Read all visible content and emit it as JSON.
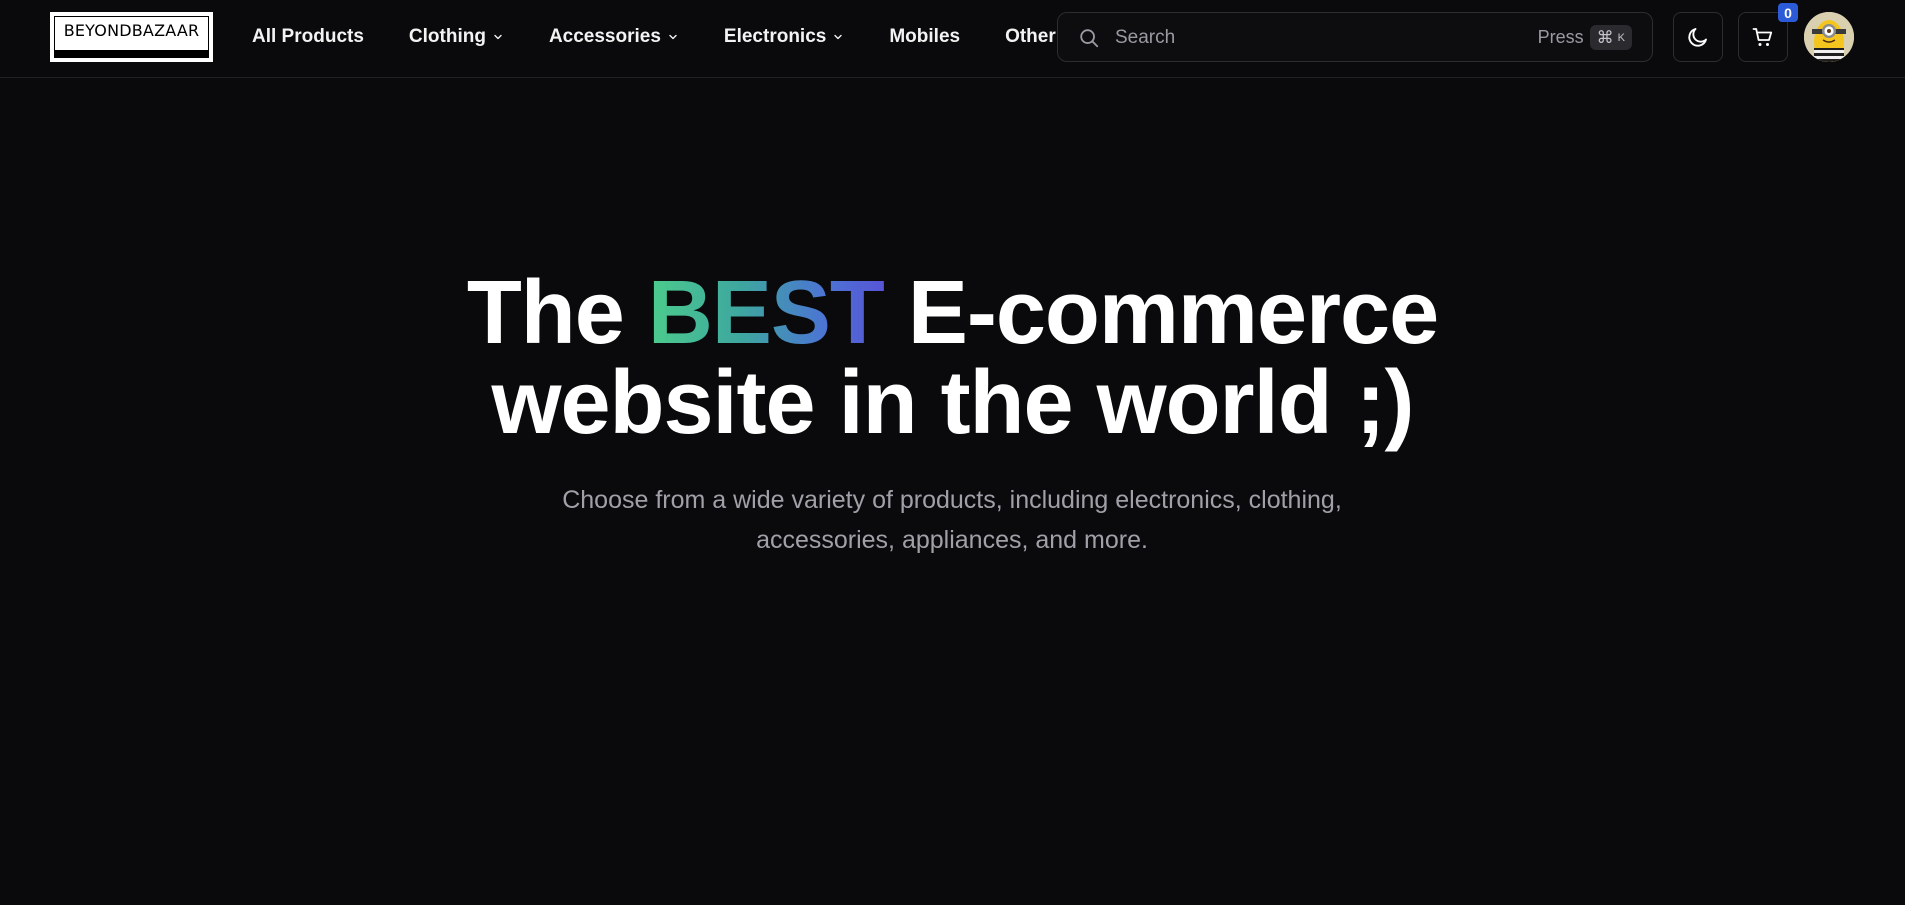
{
  "brand": {
    "logo_text": "BEYONDBAZAAR"
  },
  "nav": {
    "items": [
      {
        "label": "All Products",
        "has_dropdown": false
      },
      {
        "label": "Clothing",
        "has_dropdown": true
      },
      {
        "label": "Accessories",
        "has_dropdown": true
      },
      {
        "label": "Electronics",
        "has_dropdown": true
      },
      {
        "label": "Mobiles",
        "has_dropdown": false
      },
      {
        "label": "Other",
        "has_dropdown": false
      }
    ]
  },
  "search": {
    "placeholder": "Search",
    "shortcut_prefix": "Press",
    "shortcut_symbol": "⌘",
    "shortcut_key": "K"
  },
  "header_actions": {
    "theme_toggle_icon": "moon-icon",
    "cart_icon": "cart-icon",
    "cart_count": "0",
    "avatar": "user-avatar"
  },
  "hero": {
    "title_part1": "The ",
    "title_highlight": "BEST",
    "title_part2": " E-commerce",
    "title_line2": "website in the world ;)",
    "subtitle": "Choose from a wide variety of products, including electronics, clothing, accessories, appliances, and more."
  },
  "colors": {
    "background": "#0a0a0c",
    "accent_gradient_start": "#4ccc8c",
    "accent_gradient_end": "#5754d6",
    "badge": "#2b5bd6"
  }
}
